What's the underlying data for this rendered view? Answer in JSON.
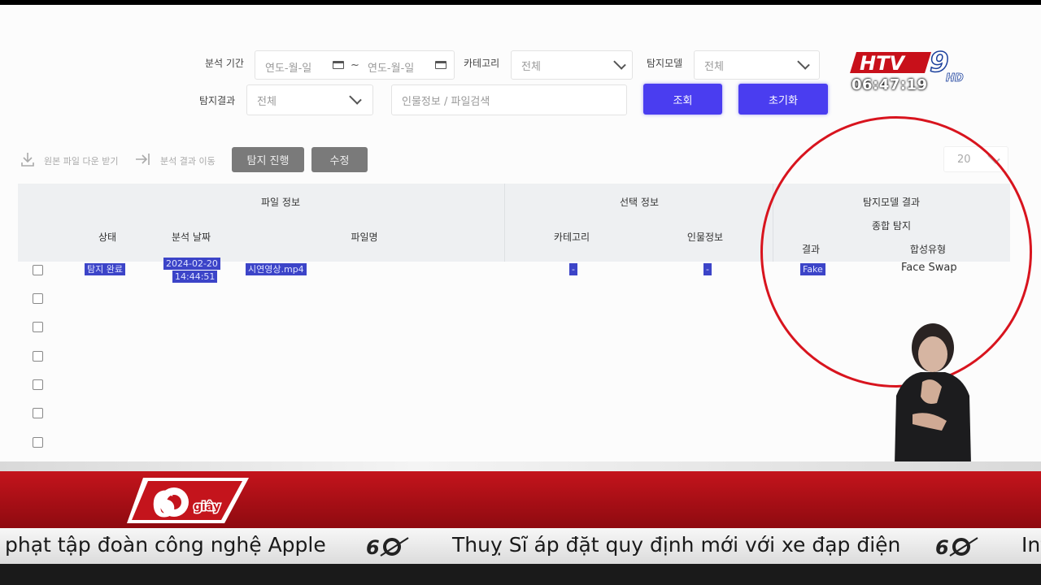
{
  "filters": {
    "period_label": "분석 기간",
    "date_from_placeholder": "연도-월-일",
    "date_sep": "~",
    "date_to_placeholder": "연도-월-일",
    "category_label": "카테고리",
    "category_value": "전체",
    "model_label": "탐지모델",
    "model_value": "전체",
    "result_label": "탐지결과",
    "result_value": "전체",
    "search_placeholder": "인물정보 / 파일검색",
    "search_button": "조회",
    "reset_button": "초기화"
  },
  "toolbar": {
    "download_label": "원본 파일 다운 받기",
    "move_label": "분석 결과 이동",
    "detect_button": "탐지 진행",
    "edit_button": "수정",
    "page_size": "20"
  },
  "table": {
    "group_file": "파일 정보",
    "group_select": "선택 정보",
    "group_model": "탐지모델 결과",
    "subgroup_total": "종합 탐지",
    "col_status": "상태",
    "col_date": "분석 날짜",
    "col_filename": "파일명",
    "col_category": "카테고리",
    "col_person": "인물정보",
    "col_result": "결과",
    "col_type": "합성유형",
    "rows": [
      {
        "status": "탐지 완료",
        "date_line1": "2024-02-20",
        "date_line2": "14:44:51",
        "filename": "시연영상.mp4",
        "category": "-",
        "person": "-",
        "result": "Fake",
        "type": "Face Swap"
      }
    ],
    "empty_row_count": 6
  },
  "broadcast": {
    "channel_logo_text": "HTV9 HD",
    "clock": "06:47:19",
    "program_logo_text": "60 giây",
    "ticker_1": "phạt tập đoàn công nghệ Apple",
    "ticker_2": "Thuỵ Sĩ áp đặt quy định mới với xe đạp điện",
    "ticker_3": "Int"
  },
  "colors": {
    "accent_blue": "#4a3df0",
    "highlight_blue": "#3c44c8",
    "annotation_red": "#d8141e",
    "banner_red": "#c4141c"
  }
}
